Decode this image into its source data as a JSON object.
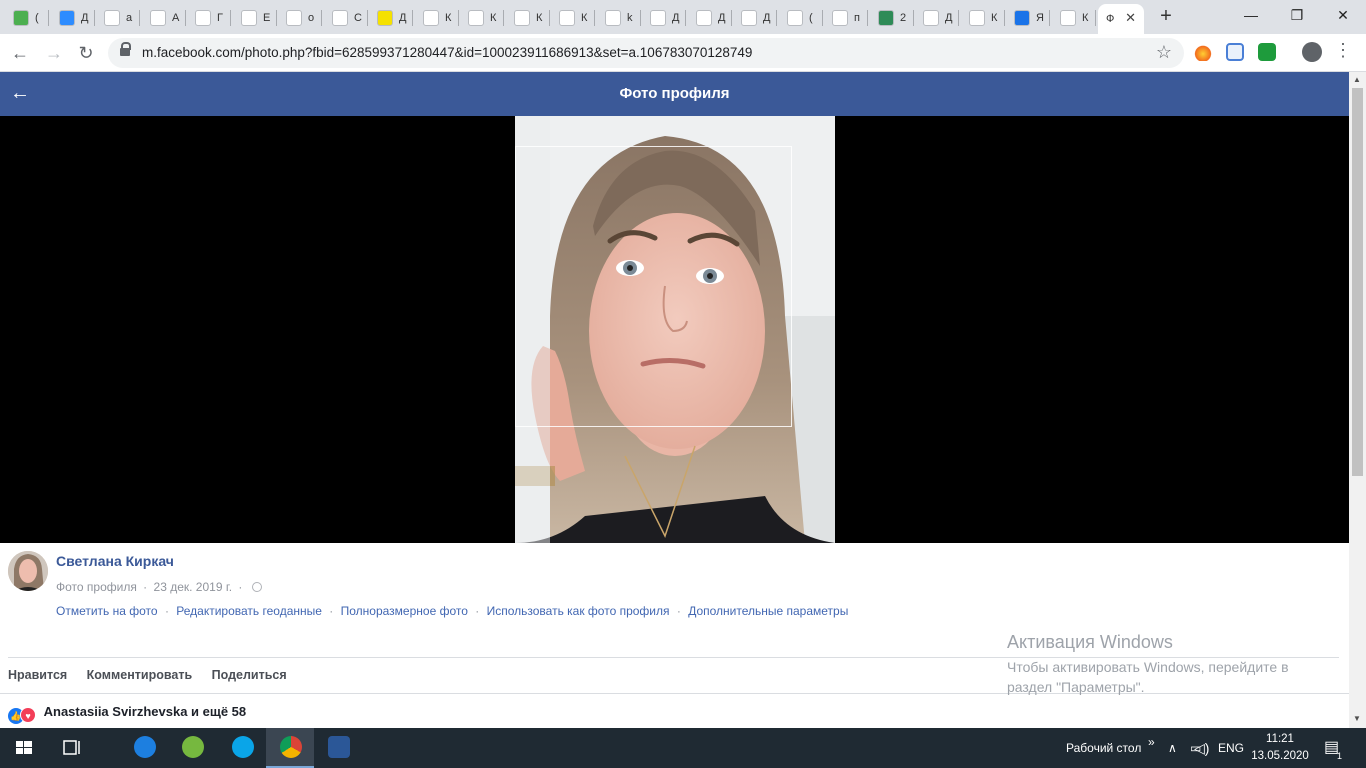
{
  "browser": {
    "active_tab": {
      "label": "Ф"
    },
    "tabs": [
      {
        "label": "("
      },
      {
        "label": "Д"
      },
      {
        "label": "a"
      },
      {
        "label": "А"
      },
      {
        "label": "Г"
      },
      {
        "label": "Е"
      },
      {
        "label": "o"
      },
      {
        "label": "С"
      },
      {
        "label": "Д"
      },
      {
        "label": "К"
      },
      {
        "label": "К"
      },
      {
        "label": "К"
      },
      {
        "label": "К"
      },
      {
        "label": "k"
      },
      {
        "label": "Д"
      },
      {
        "label": "Д"
      },
      {
        "label": "Д"
      },
      {
        "label": "("
      },
      {
        "label": "п"
      },
      {
        "label": "2"
      },
      {
        "label": "Д"
      },
      {
        "label": "К"
      },
      {
        "label": "Я"
      },
      {
        "label": "К"
      }
    ],
    "url": "m.facebook.com/photo.php?fbid=628599371280447&id=100023911686913&set=a.106783070128749"
  },
  "header": {
    "title": "Фото профиля"
  },
  "post": {
    "author": "Светлана Киркач",
    "album": "Фото профиля",
    "separator": "·",
    "date": "23 дек. 2019 г.",
    "actions": [
      "Отметить на фото",
      "Редактировать геоданные",
      "Полноразмерное фото",
      "Использовать как фото профиля",
      "Дополнительные параметры"
    ],
    "buttons": {
      "like": "Нравится",
      "comment": "Комментировать",
      "share": "Поделиться"
    },
    "reactions": "Anastasiia Svirzhevska и ещё 58"
  },
  "watermark": {
    "line1": "Активация Windows",
    "line2": "Чтобы активировать Windows, перейдите в",
    "line3": "раздел \"Параметры\"."
  },
  "taskbar": {
    "desktop_label": "Рабочий стол",
    "language": "ENG",
    "time": "11:21",
    "date": "13.05.2020",
    "notification_count": "1"
  },
  "colors": {
    "facebook_blue": "#3b5998",
    "link_blue": "#4267b2"
  }
}
